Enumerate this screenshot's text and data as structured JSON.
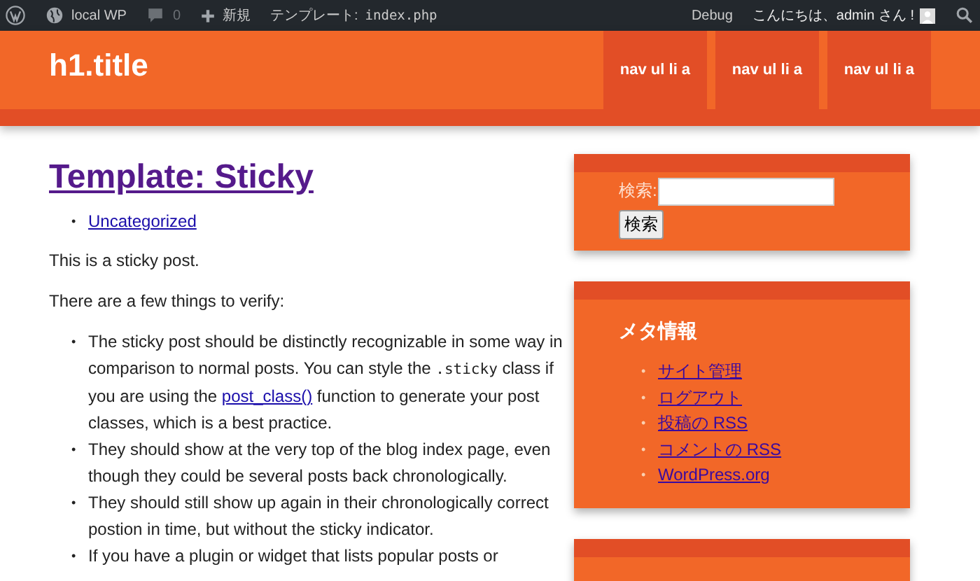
{
  "admin_bar": {
    "site": "local WP",
    "comments": "0",
    "new": "新規",
    "template": "テンプレート: ",
    "template_file": "index.php",
    "debug": "Debug",
    "greeting": "こんにちは、admin さん !"
  },
  "header": {
    "title": "h1.title",
    "nav": [
      "nav ul li a",
      "nav ul li a",
      "nav ul li a"
    ]
  },
  "post": {
    "title": "Template: Sticky",
    "bullet": "•",
    "categories": [
      "Uncategorized"
    ],
    "paragraphs": [
      "This is a sticky post.",
      "There are a few things to verify:"
    ],
    "items": [
      [
        {
          "kind": "text",
          "text": "The sticky post should be distinctly recognizable in some way in comparison to normal posts. You can style the "
        },
        {
          "kind": "code",
          "text": ".sticky"
        },
        {
          "kind": "text",
          "text": " class if you are using the "
        },
        {
          "kind": "link",
          "text": "post_class()"
        },
        {
          "kind": "text",
          "text": " function to generate your post classes, which is a best practice."
        }
      ],
      [
        {
          "kind": "text",
          "text": "They should show at the very top of the blog index page, even though they could be several posts back chronologically."
        }
      ],
      [
        {
          "kind": "text",
          "text": "They should still show up again in their chronologically correct postion in time, but without the sticky indicator."
        }
      ],
      [
        {
          "kind": "text",
          "text": "If you have a plugin or widget that lists popular posts or"
        }
      ]
    ]
  },
  "sidebar": {
    "search": {
      "label": "検索:",
      "button": "検索"
    },
    "meta": {
      "bullet": "•",
      "title": "メタ情報",
      "links": [
        "サイト管理",
        "ログアウト",
        "投稿の RSS",
        "コメントの RSS",
        "WordPress.org"
      ]
    }
  }
}
